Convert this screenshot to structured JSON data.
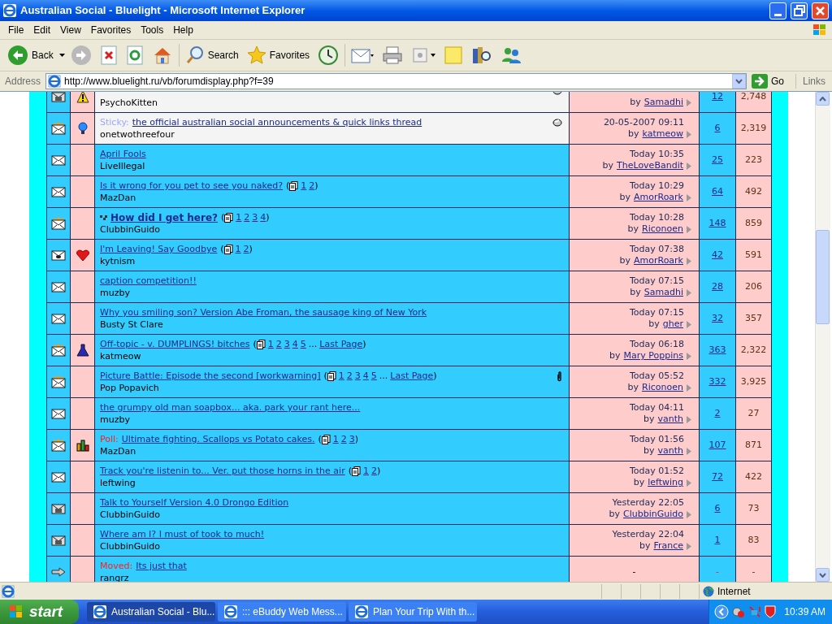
{
  "window": {
    "title": "Australian Social - Bluelight - Microsoft Internet Explorer"
  },
  "menu": [
    "File",
    "Edit",
    "View",
    "Favorites",
    "Tools",
    "Help"
  ],
  "toolbar": {
    "back": "Back",
    "search": "Search",
    "favorites": "Favorites"
  },
  "address": {
    "label": "Address",
    "url": "http://www.bluelight.ru/vb/forumdisplay.php?f=39",
    "go": "Go",
    "links": "Links"
  },
  "threads": [
    {
      "kind": "sticky",
      "status_icon": {
        "kind": "dim"
      },
      "post_icon": {
        "kind": "warning"
      },
      "note": true,
      "author": "PsychoKitten",
      "last_post": {
        "by": "by",
        "user": "Samadhi"
      },
      "replies": "12",
      "views": "2,748"
    },
    {
      "kind": "sticky",
      "status_icon": {
        "kind": "hot"
      },
      "post_icon": {
        "kind": "bulb"
      },
      "note": true,
      "prefix": "Sticky:",
      "title": "the official australian social announcements & quick links thread",
      "author": "onetwothreefour",
      "last_post": {
        "date": "20-05-2007 09:11",
        "by": "by",
        "user": "katmeow"
      },
      "replies": "6",
      "views": "2,319"
    },
    {
      "kind": "normal",
      "status_icon": {
        "kind": "plain"
      },
      "title": "April Fools",
      "author": "LiveIllegal",
      "last_post": {
        "date": "Today 10:35",
        "by": "by",
        "user": "TheLoveBandit"
      },
      "replies": "25",
      "views": "223"
    },
    {
      "kind": "normal",
      "status_icon": {
        "kind": "plain"
      },
      "title": "Is it wrong for you pet to see you naked?",
      "pages": {
        "open": "(",
        "links": [
          "1",
          "2"
        ],
        "close": ")"
      },
      "author": "MazDan",
      "last_post": {
        "date": "Today 10:29",
        "by": "by",
        "user": "AmorRoark"
      },
      "replies": "64",
      "views": "492"
    },
    {
      "kind": "normal",
      "status_icon": {
        "kind": "hot"
      },
      "new_marker": true,
      "bold": true,
      "title": "How did I get here?",
      "pages": {
        "open": "(",
        "links": [
          "1",
          "2",
          "3",
          "4"
        ],
        "close": ")"
      },
      "author": "ClubbinGuido",
      "last_post": {
        "date": "Today 10:28",
        "by": "by",
        "user": "Riconoen"
      },
      "replies": "148",
      "views": "859"
    },
    {
      "kind": "normal",
      "status_icon": {
        "kind": "dot"
      },
      "post_icon": {
        "kind": "heart"
      },
      "title": "I'm Leaving! Say Goodbye",
      "pages": {
        "open": "(",
        "links": [
          "1",
          "2"
        ],
        "close": ")"
      },
      "author": "kytnism",
      "last_post": {
        "date": "Today 07:38",
        "by": "by",
        "user": "AmorRoark"
      },
      "replies": "42",
      "views": "591"
    },
    {
      "kind": "normal",
      "status_icon": {
        "kind": "plain"
      },
      "title": "caption competition!!",
      "author": "muzby",
      "last_post": {
        "date": "Today 07:15",
        "by": "by",
        "user": "Samadhi"
      },
      "replies": "28",
      "views": "206"
    },
    {
      "kind": "normal",
      "status_icon": {
        "kind": "plain"
      },
      "title": "Why you smiling son? Version Abe Froman, the sausage king of New York",
      "author": "Busty St Clare",
      "last_post": {
        "date": "Today 07:15",
        "by": "by",
        "user": "gher"
      },
      "replies": "32",
      "views": "357"
    },
    {
      "kind": "normal",
      "status_icon": {
        "kind": "hot"
      },
      "post_icon": {
        "kind": "flask"
      },
      "title": "Off-topic - v. DUMPLINGS! bitches",
      "pages": {
        "open": "(",
        "links": [
          "1",
          "2",
          "3",
          "4",
          "5"
        ],
        "ellipsis": "...",
        "last": "Last Page",
        "close": ")"
      },
      "author": "katmeow",
      "last_post": {
        "date": "Today 06:18",
        "by": "by",
        "user": "Mary Poppins"
      },
      "replies": "363",
      "views": "2,322"
    },
    {
      "kind": "normal",
      "status_icon": {
        "kind": "hot"
      },
      "attachment": true,
      "title": "Picture Battle: Episode the second [workwarning]",
      "pages": {
        "open": "(",
        "links": [
          "1",
          "2",
          "3",
          "4",
          "5"
        ],
        "ellipsis": "...",
        "last": "Last Page",
        "close": ")"
      },
      "author": "Pop Popavich",
      "last_post": {
        "date": "Today 05:52",
        "by": "by",
        "user": "Riconoen"
      },
      "replies": "332",
      "views": "3,925"
    },
    {
      "kind": "normal",
      "status_icon": {
        "kind": "plain"
      },
      "title": "the grumpy old man soapbox... aka. park your rant here...",
      "author": "muzby",
      "last_post": {
        "date": "Today 04:11",
        "by": "by",
        "user": "vanth"
      },
      "replies": "2",
      "views": "27"
    },
    {
      "kind": "poll",
      "status_icon": {
        "kind": "hot"
      },
      "post_icon": {
        "kind": "poll"
      },
      "prefix": "Poll:",
      "title": "Ultimate fighting. Scallops vs Potato cakes.",
      "pages": {
        "open": "(",
        "links": [
          "1",
          "2",
          "3"
        ],
        "close": ")"
      },
      "author": "MazDan",
      "last_post": {
        "date": "Today 01:56",
        "by": "by",
        "user": "vanth"
      },
      "replies": "107",
      "views": "871"
    },
    {
      "kind": "normal",
      "status_icon": {
        "kind": "plain"
      },
      "title": "Track you're listenin to... Ver. put those horns in the air",
      "pages": {
        "open": "(",
        "links": [
          "1",
          "2"
        ],
        "close": ")"
      },
      "author": "leftwing",
      "last_post": {
        "date": "Today 01:52",
        "by": "by",
        "user": "leftwing"
      },
      "replies": "72",
      "views": "422"
    },
    {
      "kind": "normal",
      "status_icon": {
        "kind": "dim"
      },
      "title": "Talk to Yourself Version 4.0 Drongo Edition",
      "author": "ClubbinGuido",
      "last_post": {
        "date": "Yesterday 22:05",
        "by": "by",
        "user": "ClubbinGuido"
      },
      "replies": "6",
      "views": "73"
    },
    {
      "kind": "normal",
      "status_icon": {
        "kind": "dim"
      },
      "title": "Where am I? I must of took to much!",
      "author": "ClubbinGuido",
      "last_post": {
        "date": "Yesterday 22:04",
        "by": "by",
        "user": "France"
      },
      "replies": "1",
      "views": "83"
    },
    {
      "kind": "moved",
      "status_icon": {
        "kind": "moved"
      },
      "prefix": "Moved:",
      "title": "Its just that",
      "author": "rangrz",
      "last_post": {
        "dash": "-"
      },
      "replies": "-",
      "views": "-"
    }
  ],
  "status_bar": {
    "zone": "Internet"
  },
  "taskbar": {
    "start": "start",
    "tasks": [
      {
        "label": "Australian Social - Blu...",
        "selected": true
      },
      {
        "label": "::: eBuddy Web Mess...",
        "selected": false
      },
      {
        "label": "Plan Your Trip With th...",
        "selected": false
      }
    ],
    "clock": "10:39 AM"
  }
}
